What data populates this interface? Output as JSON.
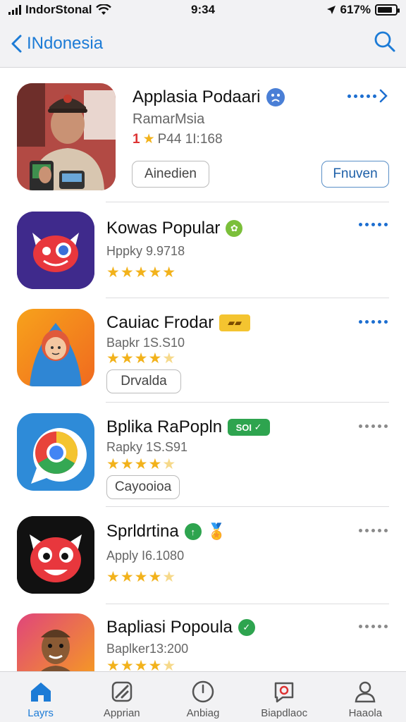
{
  "status_bar": {
    "carrier": "IndorStonal",
    "time": "9:34",
    "battery": "617%"
  },
  "nav": {
    "back_label": "INdonesia"
  },
  "featured": {
    "title": "Applasia Podaari",
    "developer": "RamarMsia",
    "rating_num": "1",
    "rating_text": "P44  1I:168",
    "button_left": "Ainedien",
    "button_right": "Fnuven"
  },
  "apps": [
    {
      "title": "Kowas Popular",
      "sub": "Hppky  9.9718",
      "stars_on": 5,
      "button": ""
    },
    {
      "title": "Cauiac Frodar",
      "sub": "Bapkr 1S.S10",
      "stars_on": 4,
      "button": "Drvalda"
    },
    {
      "title": "Bplika RaPopln",
      "badge": "SOI",
      "sub": "Rapky 1S.S91",
      "stars_on": 4,
      "button": "Cayooioa"
    },
    {
      "title": "Sprldrtina",
      "sub": "Apply I6.1080",
      "stars_on": 4,
      "button": ""
    },
    {
      "title": "Bapliasi Popoula",
      "sub": "Baplker13:200",
      "stars_on": 4,
      "button": ""
    }
  ],
  "stars": {
    "five": "★★★★★",
    "four": "★★★★",
    "one_off": "★"
  },
  "tabs": [
    {
      "label": "Layrs",
      "icon": "home-icon",
      "active": true
    },
    {
      "label": "Apprian",
      "icon": "apps-icon",
      "active": false
    },
    {
      "label": "Anbiag",
      "icon": "clock-icon",
      "active": false
    },
    {
      "label": "Biapdlaoc",
      "icon": "chat-icon",
      "active": false
    },
    {
      "label": "Haaola",
      "icon": "person-icon",
      "active": false
    }
  ],
  "colors": {
    "accent": "#1c7bd6",
    "star": "#f2b21b",
    "badge_green": "#2ea44f",
    "badge_yellow": "#f4c430"
  }
}
